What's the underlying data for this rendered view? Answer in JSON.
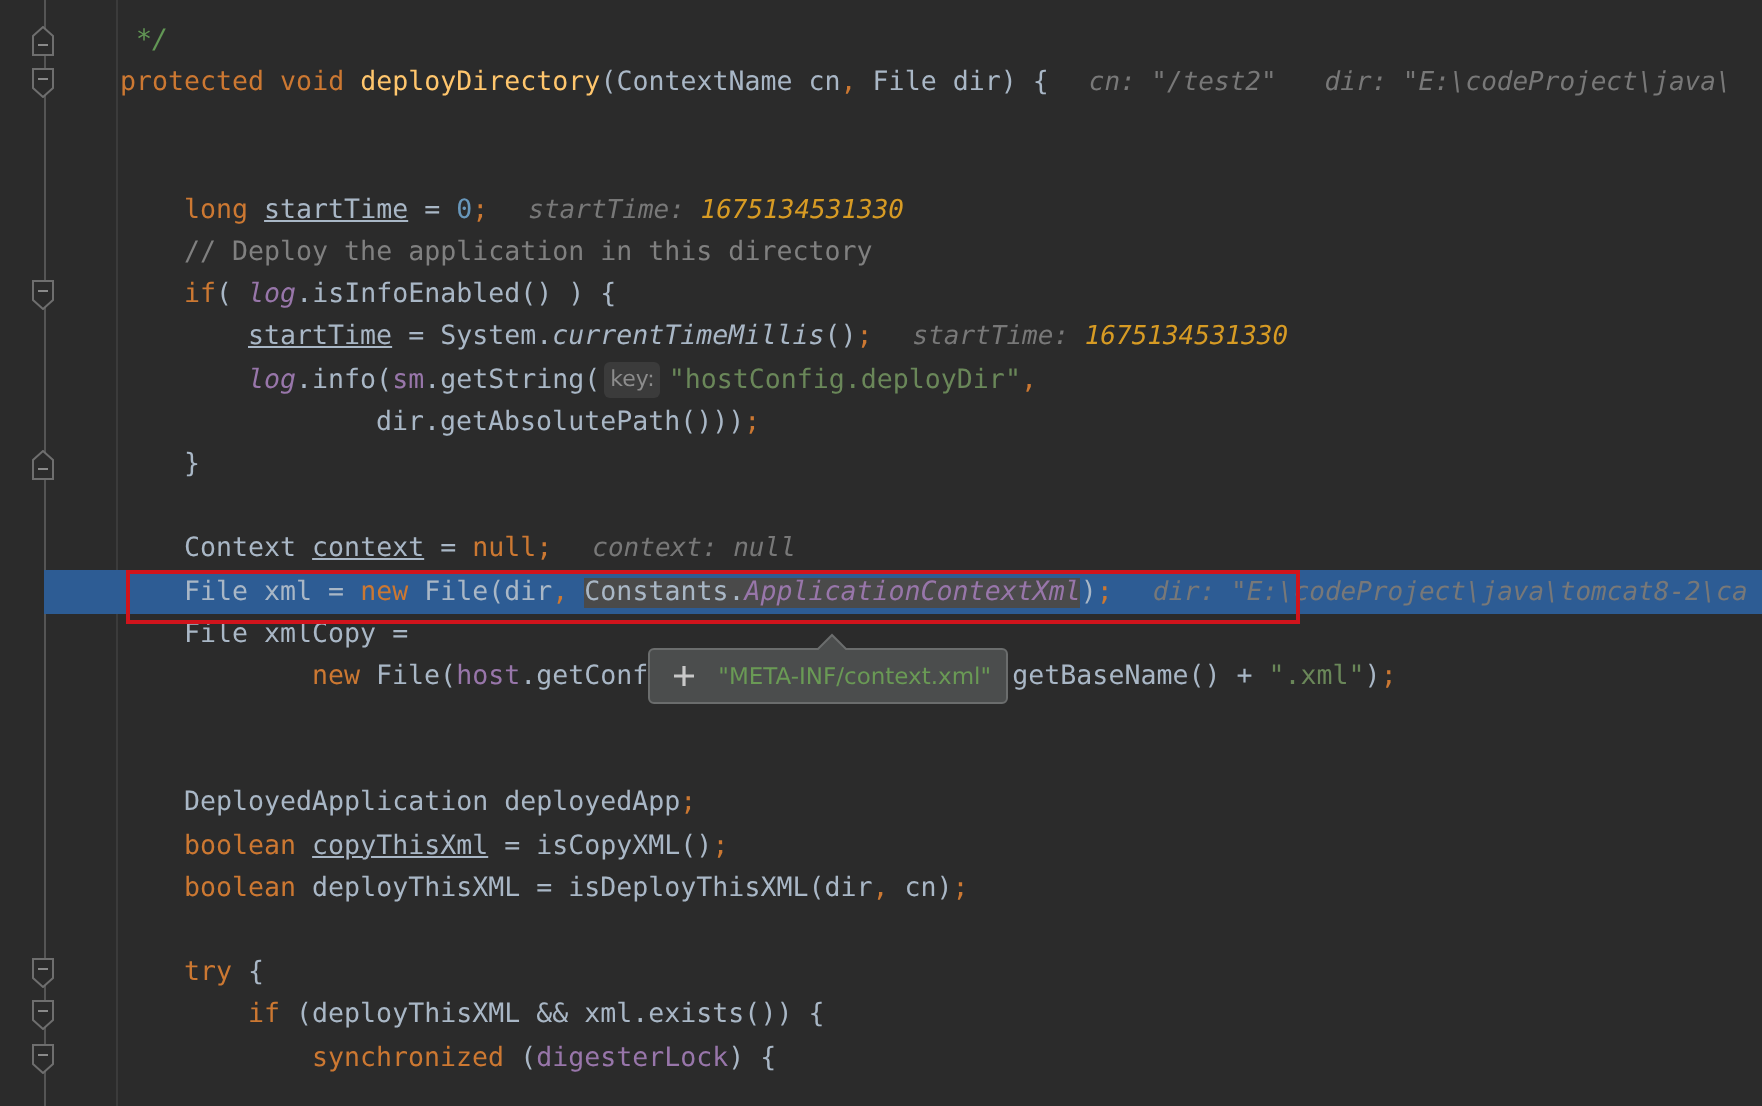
{
  "editor": {
    "lines": [
      {
        "kind": "fold_end",
        "selected": false,
        "segments": [
          {
            "kind": "code",
            "tokens": [
              {
                "kind": "doc",
                "text": " */"
              }
            ]
          }
        ]
      },
      {
        "kind": "fold_start",
        "selected": false,
        "segments": [
          {
            "kind": "code",
            "tokens": [
              {
                "kind": "kw",
                "text": "protected void "
              },
              {
                "kind": "fn",
                "text": "deployDirectory"
              },
              {
                "kind": "plain",
                "text": "(ContextName cn"
              },
              {
                "kind": "kw",
                "text": ","
              },
              {
                "kind": "plain",
                "text": " File dir) {"
              }
            ]
          },
          {
            "kind": "debug_hint",
            "tokens": [
              {
                "kind": "hint",
                "text": "cn: \"/test2\""
              }
            ]
          },
          {
            "kind": "debug_hint",
            "tokens": [
              {
                "kind": "hint",
                "text": "dir: \"E:\\codeProject\\java\\"
              }
            ]
          }
        ],
        "children": [
          {
            "kind": "blank",
            "selected": false
          },
          {
            "kind": "blank",
            "selected": false
          },
          {
            "kind": "code",
            "selected": false,
            "segments": [
              {
                "kind": "code",
                "tokens": [
                  {
                    "kind": "kw",
                    "text": "long "
                  },
                  {
                    "kind": "var",
                    "text": "startTime"
                  },
                  {
                    "kind": "plain",
                    "text": " = "
                  },
                  {
                    "kind": "num",
                    "text": "0"
                  },
                  {
                    "kind": "kw",
                    "text": ";"
                  }
                ]
              },
              {
                "kind": "debug_hint",
                "tokens": [
                  {
                    "kind": "hint",
                    "text": "startTime: "
                  },
                  {
                    "kind": "hint_num",
                    "text": "1675134531330"
                  }
                ]
              }
            ]
          },
          {
            "kind": "code",
            "selected": false,
            "segments": [
              {
                "kind": "code",
                "tokens": [
                  {
                    "kind": "comment",
                    "text": "// Deploy the application in this directory"
                  }
                ]
              }
            ]
          },
          {
            "kind": "fold_start",
            "selected": false,
            "segments": [
              {
                "kind": "code",
                "tokens": [
                  {
                    "kind": "kw",
                    "text": "if"
                  },
                  {
                    "kind": "plain",
                    "text": "( "
                  },
                  {
                    "kind": "field_italic",
                    "text": "log"
                  },
                  {
                    "kind": "plain",
                    "text": ".isInfoEnabled() ) {"
                  }
                ]
              }
            ],
            "children": [
              {
                "kind": "code",
                "selected": false,
                "segments": [
                  {
                    "kind": "code",
                    "tokens": [
                      {
                        "kind": "var",
                        "text": "startTime"
                      },
                      {
                        "kind": "plain",
                        "text": " = System."
                      },
                      {
                        "kind": "static",
                        "text": "currentTimeMillis"
                      },
                      {
                        "kind": "plain",
                        "text": "()"
                      },
                      {
                        "kind": "kw",
                        "text": ";"
                      }
                    ]
                  },
                  {
                    "kind": "debug_hint",
                    "tokens": [
                      {
                        "kind": "hint",
                        "text": "startTime: "
                      },
                      {
                        "kind": "hint_num",
                        "text": "1675134531330"
                      }
                    ]
                  }
                ]
              },
              {
                "kind": "code",
                "selected": false,
                "segments": [
                  {
                    "kind": "code",
                    "tokens": [
                      {
                        "kind": "field_italic",
                        "text": "log"
                      },
                      {
                        "kind": "plain",
                        "text": ".info("
                      },
                      {
                        "kind": "field",
                        "text": "sm"
                      },
                      {
                        "kind": "plain",
                        "text": ".getString("
                      }
                    ]
                  },
                  {
                    "kind": "param_hint",
                    "text": "key:"
                  },
                  {
                    "kind": "code",
                    "tokens": [
                      {
                        "kind": "str",
                        "text": "\"hostConfig.deployDir\""
                      },
                      {
                        "kind": "kw",
                        "text": ","
                      }
                    ]
                  }
                ]
              },
              {
                "kind": "continuation",
                "selected": false,
                "segments": [
                  {
                    "kind": "code",
                    "tokens": [
                      {
                        "kind": "plain",
                        "text": "dir.getAbsolutePath()))"
                      },
                      {
                        "kind": "kw",
                        "text": ";"
                      }
                    ]
                  }
                ]
              }
            ]
          },
          {
            "kind": "fold_end",
            "selected": false,
            "segments": [
              {
                "kind": "code",
                "tokens": [
                  {
                    "kind": "plain",
                    "text": "}"
                  }
                ]
              }
            ]
          },
          {
            "kind": "blank",
            "selected": false
          },
          {
            "kind": "code",
            "selected": false,
            "segments": [
              {
                "kind": "code",
                "tokens": [
                  {
                    "kind": "plain",
                    "text": "Context "
                  },
                  {
                    "kind": "var",
                    "text": "context"
                  },
                  {
                    "kind": "plain",
                    "text": " = "
                  },
                  {
                    "kind": "kw",
                    "text": "null;"
                  }
                ]
              },
              {
                "kind": "debug_hint",
                "tokens": [
                  {
                    "kind": "hint",
                    "text": "context: null"
                  }
                ]
              }
            ]
          },
          {
            "kind": "code",
            "selected": true,
            "segments": [
              {
                "kind": "code",
                "tokens": [
                  {
                    "kind": "plain",
                    "text": "File xml = "
                  },
                  {
                    "kind": "kw",
                    "text": "new"
                  },
                  {
                    "kind": "plain",
                    "text": " File(dir"
                  },
                  {
                    "kind": "kw",
                    "text": ", "
                  },
                  {
                    "kind": "plain",
                    "text": "Constants.",
                    "highlighted": true
                  },
                  {
                    "kind": "field_italic",
                    "text": "ApplicationContextXml",
                    "highlighted": true
                  },
                  {
                    "kind": "plain",
                    "text": ")"
                  },
                  {
                    "kind": "kw",
                    "text": ";"
                  }
                ]
              },
              {
                "kind": "debug_hint",
                "tokens": [
                  {
                    "kind": "hint",
                    "text": "dir: \"E:\\codeProject\\java\\tomcat8-2\\ca"
                  }
                ]
              }
            ]
          },
          {
            "kind": "code",
            "selected": false,
            "segments": [
              {
                "kind": "code",
                "tokens": [
                  {
                    "kind": "plain",
                    "text": "File xmlCopy ="
                  }
                ]
              }
            ]
          },
          {
            "kind": "continuation",
            "selected": false,
            "segments": [
              {
                "kind": "code",
                "tokens": [
                  {
                    "kind": "kw",
                    "text": "new"
                  },
                  {
                    "kind": "plain",
                    "text": " File("
                  },
                  {
                    "kind": "field",
                    "text": "host"
                  },
                  {
                    "kind": "plain",
                    "text": ".getConf"
                  }
                ]
              },
              {
                "kind": "tooltip",
                "text": "\"META-INF/context.xml\""
              },
              {
                "kind": "code",
                "tokens": [
                  {
                    "kind": "plain",
                    "text": "getBaseName() + "
                  },
                  {
                    "kind": "str",
                    "text": "\".xml\""
                  },
                  {
                    "kind": "plain",
                    "text": ")"
                  },
                  {
                    "kind": "kw",
                    "text": ";"
                  }
                ]
              }
            ]
          },
          {
            "kind": "blank",
            "selected": false
          },
          {
            "kind": "blank",
            "selected": false
          },
          {
            "kind": "code",
            "selected": false,
            "segments": [
              {
                "kind": "code",
                "tokens": [
                  {
                    "kind": "plain",
                    "text": "DeployedApplication deployedApp"
                  },
                  {
                    "kind": "kw",
                    "text": ";"
                  }
                ]
              }
            ]
          },
          {
            "kind": "code",
            "selected": false,
            "segments": [
              {
                "kind": "code",
                "tokens": [
                  {
                    "kind": "kw",
                    "text": "boolean "
                  },
                  {
                    "kind": "var",
                    "text": "copyThisXml"
                  },
                  {
                    "kind": "plain",
                    "text": " = isCopyXML()"
                  },
                  {
                    "kind": "kw",
                    "text": ";"
                  }
                ]
              }
            ]
          },
          {
            "kind": "code",
            "selected": false,
            "segments": [
              {
                "kind": "code",
                "tokens": [
                  {
                    "kind": "kw",
                    "text": "boolean "
                  },
                  {
                    "kind": "plain",
                    "text": "deployThisXML = isDeployThisXML(dir"
                  },
                  {
                    "kind": "kw",
                    "text": ","
                  },
                  {
                    "kind": "plain",
                    "text": " cn)"
                  },
                  {
                    "kind": "kw",
                    "text": ";"
                  }
                ]
              }
            ]
          },
          {
            "kind": "blank",
            "selected": false
          },
          {
            "kind": "fold_start",
            "selected": false,
            "segments": [
              {
                "kind": "code",
                "tokens": [
                  {
                    "kind": "kw",
                    "text": "try "
                  },
                  {
                    "kind": "plain",
                    "text": "{"
                  }
                ]
              }
            ],
            "children": [
              {
                "kind": "fold_start",
                "selected": false,
                "segments": [
                  {
                    "kind": "code",
                    "tokens": [
                      {
                        "kind": "kw",
                        "text": "if "
                      },
                      {
                        "kind": "plain",
                        "text": "(deployThisXML && xml.exists()) {"
                      }
                    ]
                  }
                ],
                "children": [
                  {
                    "kind": "fold_start",
                    "selected": false,
                    "segments": [
                      {
                        "kind": "code",
                        "tokens": [
                          {
                            "kind": "kw",
                            "text": "synchronized "
                          },
                          {
                            "kind": "plain",
                            "text": "("
                          },
                          {
                            "kind": "field",
                            "text": "digesterLock"
                          },
                          {
                            "kind": "plain",
                            "text": ") {"
                          }
                        ]
                      }
                    ]
                  }
                ]
              }
            ]
          }
        ]
      }
    ]
  }
}
